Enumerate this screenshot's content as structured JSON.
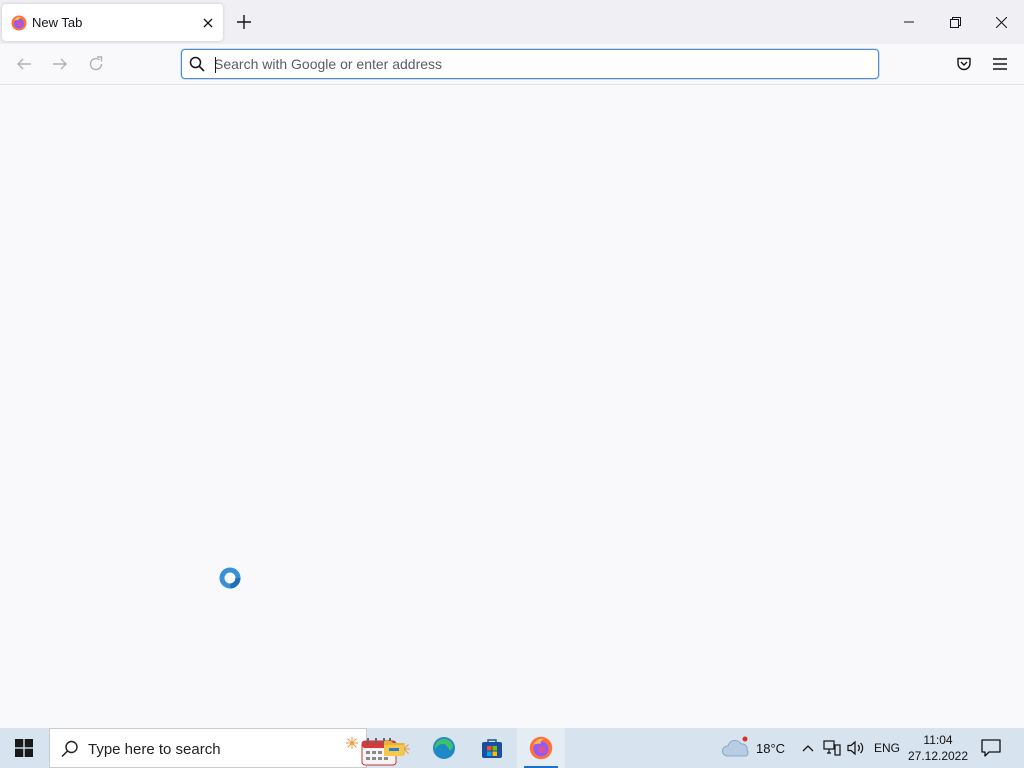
{
  "browser": {
    "tab": {
      "title": "New Tab",
      "favicon_icon": "firefox-logo-icon",
      "close_icon": "close-icon"
    },
    "new_tab_icon": "plus-icon",
    "window_controls": {
      "minimize_icon": "minimize-icon",
      "maximize_icon": "restore-icon",
      "close_icon": "close-icon"
    },
    "nav": {
      "back_icon": "arrow-left-icon",
      "forward_icon": "arrow-right-icon",
      "reload_icon": "reload-icon"
    },
    "urlbar": {
      "placeholder": "Search with Google or enter address",
      "value": "",
      "icon": "search-icon"
    },
    "toolbar": {
      "pocket_icon": "pocket-icon",
      "menu_icon": "hamburger-menu-icon"
    },
    "accent_color": "#4f8fd6"
  },
  "taskbar": {
    "start_icon": "windows-logo-icon",
    "search": {
      "placeholder": "Type here to search",
      "icon": "search-icon",
      "highlight_icon": "calendar-celebration-icon"
    },
    "apps": [
      {
        "name": "File Explorer",
        "icon": "folder-icon",
        "active": false
      },
      {
        "name": "Microsoft Edge",
        "icon": "edge-icon",
        "active": false
      },
      {
        "name": "Microsoft Store",
        "icon": "store-icon",
        "active": false
      },
      {
        "name": "Firefox",
        "icon": "firefox-logo-icon",
        "active": true
      }
    ],
    "tray": {
      "weather_icon": "cloud-icon",
      "temperature": "18°C",
      "chevron_icon": "chevron-up-icon",
      "network_icon": "network-icon",
      "volume_icon": "volume-icon",
      "language": "ENG",
      "time": "11:04",
      "date": "27.12.2022",
      "notification_icon": "notification-icon"
    },
    "background_color": "#d7e3ef"
  }
}
